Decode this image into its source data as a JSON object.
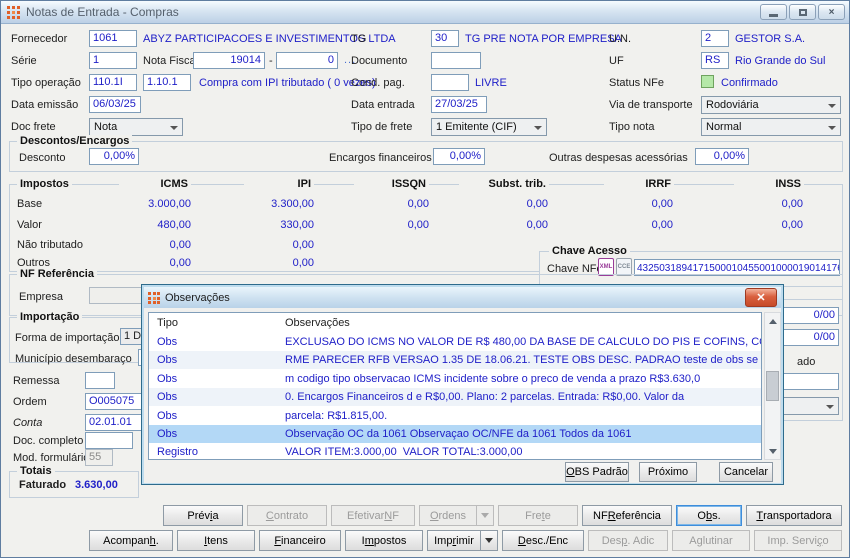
{
  "window": {
    "title": "Notas de Entrada - Compras"
  },
  "form": {
    "fornecedor": {
      "label": "Fornecedor",
      "code": "1061",
      "desc": "ABYZ PARTICIPACOES E INVESTIMENTOS LTDA"
    },
    "tg": {
      "label": "TG",
      "code": "30",
      "desc": "TG PRE NOTA POR EMPRESA"
    },
    "un": {
      "label": "U.N.",
      "code": "2",
      "desc": "GESTOR S.A."
    },
    "serie": {
      "label": "Série",
      "value": "1"
    },
    "nota_fiscal": {
      "label": "Nota Fiscal",
      "numero": "19014",
      "dash": "-",
      "sufixo": "0",
      "more": "..."
    },
    "documento": {
      "label": "Documento",
      "value": ""
    },
    "uf": {
      "label": "UF",
      "code": "RS",
      "desc": "Rio Grande do Sul"
    },
    "tipo_operacao": {
      "label": "Tipo operação",
      "code1": "110.1I",
      "code2": "1.10.1",
      "desc": "Compra com IPI tributado ( 0 vezes)"
    },
    "cond_pag": {
      "label": "Cond. pag.",
      "value": "",
      "desc": "LIVRE"
    },
    "status_nfe": {
      "label": "Status NFe",
      "value": "Confirmado"
    },
    "data_emissao": {
      "label": "Data emissão",
      "value": "06/03/25"
    },
    "data_entrada": {
      "label": "Data entrada",
      "value": "27/03/25"
    },
    "via_transporte": {
      "label": "Via de transporte",
      "value": "Rodoviária"
    },
    "doc_frete": {
      "label": "Doc frete",
      "value": "Nota"
    },
    "tipo_frete": {
      "label": "Tipo de frete",
      "value": "1 Emitente (CIF)"
    },
    "tipo_nota": {
      "label": "Tipo nota",
      "value": "Normal"
    }
  },
  "descontos": {
    "title": "Descontos/Encargos",
    "desconto_label": "Desconto",
    "desconto_value": "0,00%",
    "encargos_label": "Encargos financeiros",
    "encargos_value": "0,00%",
    "outras_label": "Outras despesas acessórias",
    "outras_value": "0,00%"
  },
  "impostos": {
    "title": "Impostos",
    "columns": [
      "ICMS",
      "IPI",
      "ISSQN",
      "Subst. trib.",
      "IRRF",
      "INSS"
    ],
    "rows": [
      {
        "label": "Base",
        "values": [
          "3.000,00",
          "3.300,00",
          "0,00",
          "0,00",
          "0,00",
          "0,00"
        ]
      },
      {
        "label": "Valor",
        "values": [
          "480,00",
          "330,00",
          "0,00",
          "0,00",
          "0,00",
          "0,00"
        ]
      },
      {
        "label": "Não tributado",
        "values": [
          "0,00",
          "0,00"
        ]
      },
      {
        "label": "Outros",
        "values": [
          "0,00",
          "0,00"
        ]
      }
    ]
  },
  "chave_acesso": {
    "title": "Chave Acesso",
    "label": "Chave NFe",
    "xml_icon": "XML",
    "cce_icon": "CCE",
    "value": "4325031894171500010455001000019014176"
  },
  "nf_referencia": {
    "title": "NF Referência",
    "empresa_label": "Empresa"
  },
  "importacao": {
    "title": "Importação",
    "forma_label": "Forma de importação",
    "forma_value": "1 D",
    "municipio_label": "Município desembaraço"
  },
  "campos_esquerda": {
    "remessa_label": "Remessa",
    "ordem_label": "Ordem",
    "ordem_value": "O005075",
    "conta_label": "Conta",
    "conta_value": "02.01.01",
    "doc_completo_label": "Doc. completo",
    "mod_formulario_label": "Mod. formulário",
    "mod_formulario_value": "55"
  },
  "totais": {
    "title": "Totais",
    "faturado_label": "Faturado",
    "faturado_value": "3.630,00"
  },
  "campos_direita": {
    "valor1": "0/00",
    "valor2": "0/00",
    "label_parcial": "ado"
  },
  "dialog": {
    "title": "Observações",
    "col_tipo": "Tipo",
    "col_obs": "Observações",
    "rows": [
      {
        "tipo": "Obs",
        "texto": "EXCLUSAO DO ICMS NO VALOR DE R$ 480,00 DA BASE DE CALCULO DO PIS E COFINS, CONFO"
      },
      {
        "tipo": "Obs",
        "texto": "RME PARECER RFB VERSAO 1.35 DE 18.06.21. TESTE OBS DESC. PADRAO teste de obs se"
      },
      {
        "tipo": "Obs",
        "texto": "m codigo tipo observacao ICMS incidente sobre o preco de venda a prazo R$3.630,0"
      },
      {
        "tipo": "Obs",
        "texto": "0. Encargos Financeiros d e R$0,00. Plano: 2 parcelas. Entrada: R$0,00. Valor da"
      },
      {
        "tipo": "Obs",
        "texto": "parcela: R$1.815,00."
      },
      {
        "tipo": "Obs",
        "texto": "Observação OC da 1061 Observaçao OC/NFE da 1061 Todos da 1061",
        "selected": true
      },
      {
        "tipo": "Registro",
        "texto": "VALOR ITEM:3.000,00  VALOR TOTAL:3.000,00"
      }
    ],
    "buttons": {
      "obs_padrao": "&OBS Padrão",
      "proximo": "Próximo",
      "cancelar": "Cancelar"
    }
  },
  "buttons": {
    "row1": [
      {
        "label": "Prév&ia",
        "enabled": true
      },
      {
        "label": "&Contrato",
        "enabled": false
      },
      {
        "label": "Efetivar &NF",
        "enabled": false
      },
      {
        "label": "&Ordens",
        "enabled": false,
        "dropdown": true
      },
      {
        "label": "Fre&te",
        "enabled": false
      },
      {
        "label": "NF &Referência",
        "enabled": true
      },
      {
        "label": "O&bs.",
        "enabled": true,
        "focused": true
      },
      {
        "label": "&Transportadora",
        "enabled": true
      }
    ],
    "row2": [
      {
        "label": "Acompan&h.",
        "enabled": true
      },
      {
        "label": "&Itens",
        "enabled": true
      },
      {
        "label": "&Financeiro",
        "enabled": true
      },
      {
        "label": "I&mpostos",
        "enabled": true
      },
      {
        "label": "Imp&rimir",
        "enabled": true,
        "dropdown": true
      },
      {
        "label": "&Desc./Enc",
        "enabled": true
      },
      {
        "label": "Des&p. Adic",
        "enabled": false
      },
      {
        "label": "A&glutinar",
        "enabled": false
      },
      {
        "label": "Imp. Servi&ço",
        "enabled": false
      }
    ]
  },
  "colors": {
    "accent_text": "#2020c8",
    "status_ok": "#b5e8a8",
    "selection": "#b3d8f6",
    "titlebar": "#cfe0f0",
    "focus_border": "#3e8ddb"
  }
}
